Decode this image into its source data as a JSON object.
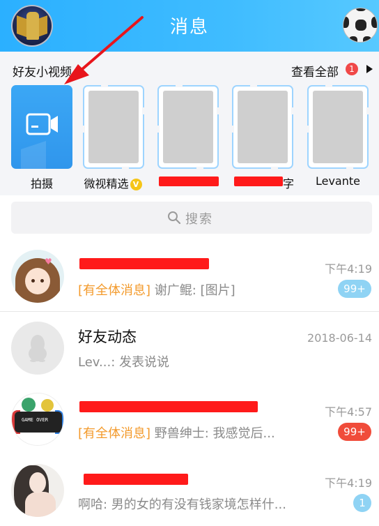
{
  "header": {
    "title": "消息"
  },
  "friend_videos": {
    "title": "好友小视频",
    "view_all": "查看全部",
    "view_all_badge": "1",
    "items": [
      {
        "label": "拍摄"
      },
      {
        "label": "微视精选",
        "badge": "V"
      },
      {
        "label": ""
      },
      {
        "label": "字"
      },
      {
        "label": "Levante"
      }
    ]
  },
  "search": {
    "placeholder": "搜索"
  },
  "conversations": [
    {
      "name": "",
      "tag": "[有全体消息]",
      "preview": " 谢广鲲: [图片]",
      "time": "下午4:19",
      "count": "99+",
      "muted": true
    },
    {
      "name": "好友动态",
      "tag": "",
      "preview": "Lev...: 发表说说",
      "time": "2018-06-14",
      "count": "",
      "muted": false
    },
    {
      "name": "",
      "tag": "[有全体消息]",
      "preview": " 野兽绅士: 我感觉后...",
      "time": "下午4:57",
      "count": "99+",
      "muted": false
    },
    {
      "name": "",
      "tag": "",
      "preview": "啊哈: 男的女的有没有钱家境怎样什...",
      "time": "下午4:19",
      "count": "1",
      "muted": true
    }
  ],
  "colors": {
    "header": "#3fbcff",
    "accent_orange": "#f39a2b",
    "badge_red": "#f04c3a",
    "badge_muted": "#8fd3f4",
    "annotation": "#e8151b"
  }
}
